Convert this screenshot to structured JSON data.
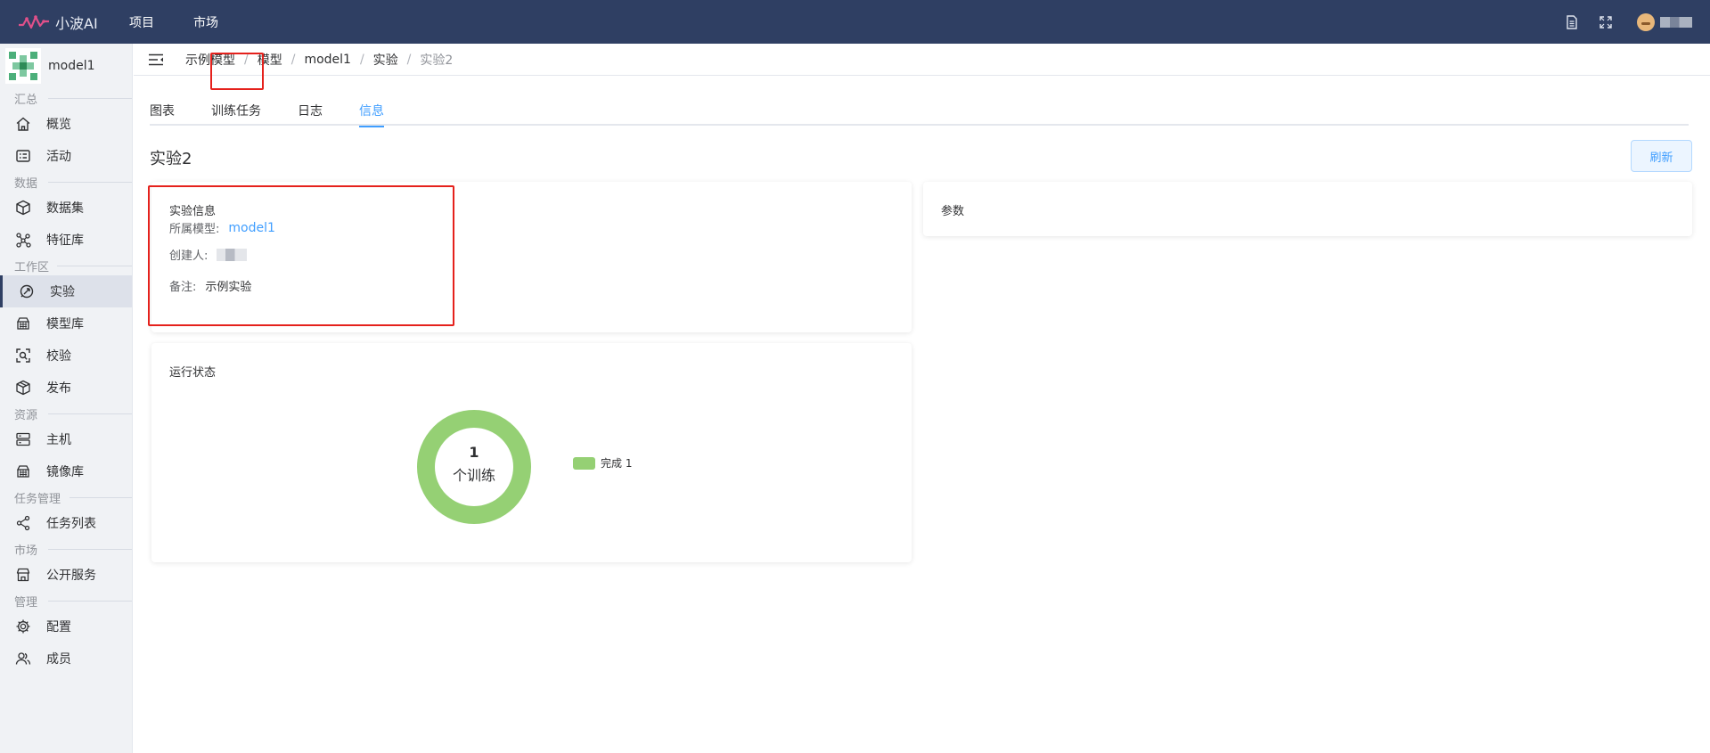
{
  "app": {
    "logo_text": "小波AI",
    "nav": [
      {
        "label": "项目"
      },
      {
        "label": "市场"
      }
    ],
    "icons": [
      "document-icon",
      "fullscreen-icon",
      "avatar"
    ]
  },
  "sidebar": {
    "model_name": "model1",
    "groups": {
      "summary": "汇总",
      "data": "数据",
      "workspace": "工作区",
      "resources": "资源",
      "tasks": "任务管理",
      "market": "市场",
      "admin": "管理"
    },
    "items": {
      "overview": "概览",
      "activity": "活动",
      "dataset": "数据集",
      "features": "特征库",
      "experiment": "实验",
      "model_repo": "模型库",
      "validation": "校验",
      "publish": "发布",
      "host": "主机",
      "image_repo": "镜像库",
      "task_list": "任务列表",
      "public_service": "公开服务",
      "config": "配置",
      "members": "成员"
    }
  },
  "breadcrumb": [
    "示例模型",
    "模型",
    "model1",
    "实验",
    "实验2"
  ],
  "tabs": [
    {
      "label": "图表",
      "active": false
    },
    {
      "label": "训练任务",
      "active": false
    },
    {
      "label": "日志",
      "active": false
    },
    {
      "label": "信息",
      "active": true
    }
  ],
  "page": {
    "title": "实验2",
    "refresh_label": "刷新"
  },
  "info_card": {
    "title": "实验信息",
    "model_label": "所属模型:",
    "model_value": "model1",
    "creator_label": "创建人:",
    "note_label": "备注:",
    "note_value": "示例实验"
  },
  "params_card": {
    "title": "参数"
  },
  "status_card": {
    "title": "运行状态",
    "center_count": "1",
    "center_label": "个训练",
    "legend": [
      {
        "label": "完成 1",
        "value": 1,
        "color": "#95d074"
      }
    ]
  },
  "colors": {
    "topbar": "#2f3f63",
    "accent": "#409eff",
    "highlight": "#e5211c",
    "complete": "#95d074"
  }
}
